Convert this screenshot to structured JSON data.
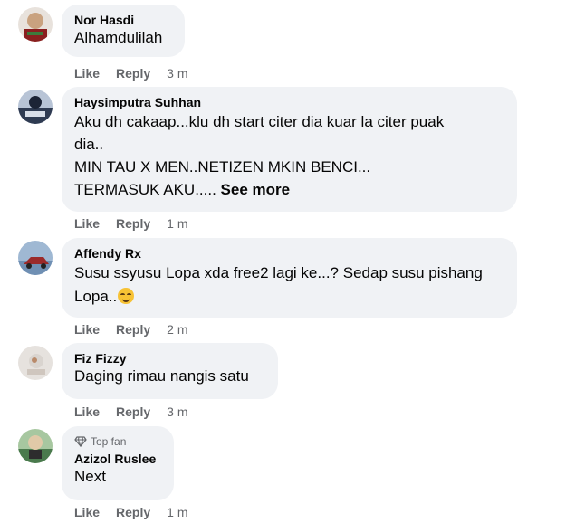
{
  "comments": [
    {
      "author": "Nor Hasdi",
      "lines": [
        "Alhamdulilah"
      ],
      "like": "Like",
      "reply": "Reply",
      "time": "3 m",
      "avatar_colors": [
        "#c9a27f",
        "#8a1f1f"
      ]
    },
    {
      "author": "Haysimputra Suhhan",
      "lines": [
        "Aku dh cakaap...klu dh start citer dia kuar la citer puak",
        "dia..",
        "MIN TAU X MEN..NETIZEN MKIN BENCI...",
        "TERMASUK AKU....."
      ],
      "see_more": "See more",
      "like": "Like",
      "reply": "Reply",
      "time": "1 m",
      "avatar_colors": [
        "#2f3b52",
        "#b8c4d6"
      ]
    },
    {
      "author": "Affendy Rx",
      "lines": [
        "Susu ssyusu Lopa xda free2 lagi ke...? Sedap susu pishang",
        "Lopa.."
      ],
      "like": "Like",
      "reply": "Reply",
      "time": "2 m",
      "avatar_colors": [
        "#6f8fb3",
        "#9b2a2a"
      ]
    },
    {
      "author": "Fiz Fizzy",
      "lines": [
        "Daging rimau nangis satu"
      ],
      "like": "Like",
      "reply": "Reply",
      "time": "3 m",
      "avatar_colors": [
        "#d9d4cf",
        "#b98a6a"
      ]
    },
    {
      "badge": "Top fan",
      "author": "Azizol Ruslee",
      "lines": [
        "Next"
      ],
      "like": "Like",
      "reply": "Reply",
      "time": "1 m",
      "avatar_colors": [
        "#4a7a4d",
        "#e0c9a8"
      ]
    }
  ],
  "icons": {
    "top_fan": "diamond-icon",
    "emoji": "smiling-face-emoji"
  },
  "colors": {
    "bubble_bg": "#f0f2f5",
    "secondary_text": "#65676b",
    "primary_text": "#050505"
  }
}
